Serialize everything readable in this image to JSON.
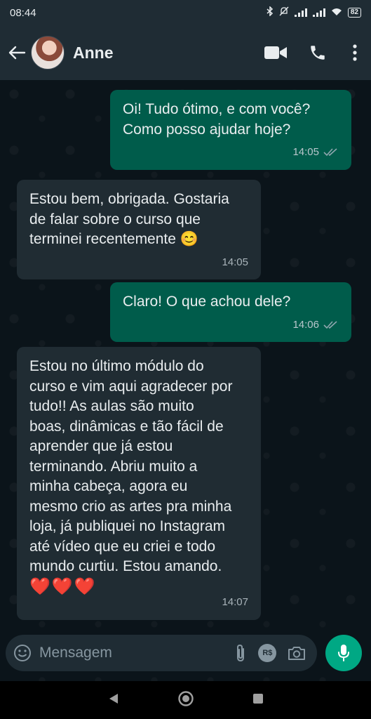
{
  "status": {
    "time": "08:44",
    "battery": "82"
  },
  "header": {
    "contact_name": "Anne"
  },
  "messages": [
    {
      "direction": "out",
      "text": "Oi! Tudo ótimo, e com você?\nComo posso ajudar hoje?",
      "time": "14:05"
    },
    {
      "direction": "in",
      "text": "Estou bem, obrigada. Gostaria\nde falar sobre o curso que\nterminei recentemente 😊",
      "time": "14:05"
    },
    {
      "direction": "out",
      "text": "Claro! O que achou dele?",
      "time": "14:06"
    },
    {
      "direction": "in",
      "text": "Estou no último módulo do\ncurso e vim aqui agradecer por\ntudo!! As aulas são muito\nboas, dinâmicas e tão fácil de\naprender que já estou\nterminando. Abriu muito a\nminha cabeça, agora eu\nmesmo crio as artes pra minha\nloja, já publiquei no Instagram\naté vídeo que eu criei e todo\nmundo curtiu. Estou amando.",
      "emoji_line": "❤️❤️❤️",
      "time": "14:07"
    }
  ],
  "input": {
    "placeholder": "Mensagem",
    "value": "",
    "payment_label": "R$"
  },
  "icons": {
    "back": "arrow-left-icon",
    "video": "video-call-icon",
    "call": "phone-icon",
    "menu": "more-vertical-icon",
    "emoji": "emoji-icon",
    "attach": "paperclip-icon",
    "camera": "camera-icon",
    "mic": "microphone-icon",
    "read": "double-check-icon"
  },
  "colors": {
    "accent": "#00a884",
    "outgoing_bubble": "#005c4b",
    "incoming_bubble": "#202c33",
    "background": "#0b141a",
    "bar": "#1f2c34"
  }
}
